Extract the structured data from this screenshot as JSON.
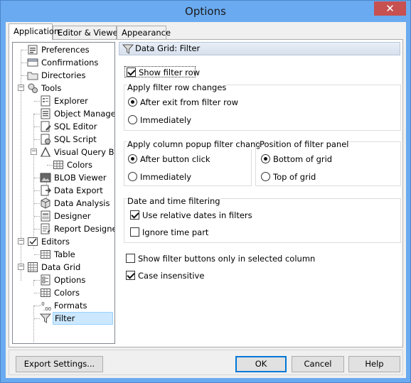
{
  "window": {
    "title": "Options",
    "close_glyph": "✕"
  },
  "tabs": [
    {
      "label": "Application",
      "active": true
    },
    {
      "label": "Editor & Viewers",
      "active": false
    },
    {
      "label": "Appearance",
      "active": false
    }
  ],
  "tree": [
    {
      "label": "Preferences",
      "icon": "preferences-icon"
    },
    {
      "label": "Confirmations",
      "icon": "confirmations-icon"
    },
    {
      "label": "Directories",
      "icon": "folder-icon"
    },
    {
      "label": "Tools",
      "icon": "tools-icon"
    },
    {
      "label": "Explorer",
      "icon": "explorer-icon"
    },
    {
      "label": "Object Manager",
      "icon": "object-manager-icon"
    },
    {
      "label": "SQL Editor",
      "icon": "sql-editor-icon"
    },
    {
      "label": "SQL Script",
      "icon": "sql-script-icon"
    },
    {
      "label": "Visual Query Builder",
      "icon": "query-builder-icon"
    },
    {
      "label": "Colors",
      "icon": "colors-icon"
    },
    {
      "label": "BLOB Viewer",
      "icon": "blob-viewer-icon"
    },
    {
      "label": "Data Export",
      "icon": "data-export-icon"
    },
    {
      "label": "Data Analysis",
      "icon": "data-analysis-icon"
    },
    {
      "label": "Designer",
      "icon": "designer-icon"
    },
    {
      "label": "Report Designer",
      "icon": "report-designer-icon"
    },
    {
      "label": "Editors",
      "icon": "editors-icon"
    },
    {
      "label": "Table",
      "icon": "table-icon"
    },
    {
      "label": "Data Grid",
      "icon": "data-grid-icon"
    },
    {
      "label": "Options",
      "icon": "options-icon"
    },
    {
      "label": "Colors",
      "icon": "colors-icon"
    },
    {
      "label": "Formats",
      "icon": "formats-icon"
    },
    {
      "label": "Filter",
      "icon": "filter-icon",
      "selected": true
    }
  ],
  "pane": {
    "header": "Data Grid: Filter",
    "show_filter_row": {
      "label": "Show filter row",
      "checked": true
    },
    "apply_filter_row": {
      "title": "Apply filter row changes",
      "options": [
        {
          "label": "After exit from filter row",
          "selected": true
        },
        {
          "label": "Immediately",
          "selected": false
        }
      ]
    },
    "apply_column_popup": {
      "title": "Apply column popup filter changes",
      "options": [
        {
          "label": "After button click",
          "selected": true
        },
        {
          "label": "Immediately",
          "selected": false
        }
      ]
    },
    "filter_panel_position": {
      "title": "Position of filter panel",
      "options": [
        {
          "label": "Bottom of grid",
          "selected": true
        },
        {
          "label": "Top of grid",
          "selected": false
        }
      ]
    },
    "date_time": {
      "title": "Date and time filtering",
      "use_relative": {
        "label": "Use relative dates in filters",
        "checked": true
      },
      "ignore_time": {
        "label": "Ignore time part",
        "checked": false
      }
    },
    "show_buttons_selected": {
      "label": "Show filter buttons only in selected column",
      "checked": false
    },
    "case_insensitive": {
      "label": "Case insensitive",
      "checked": true
    }
  },
  "buttons": {
    "export": "Export Settings...",
    "ok": "OK",
    "cancel": "Cancel",
    "help": "Help"
  }
}
